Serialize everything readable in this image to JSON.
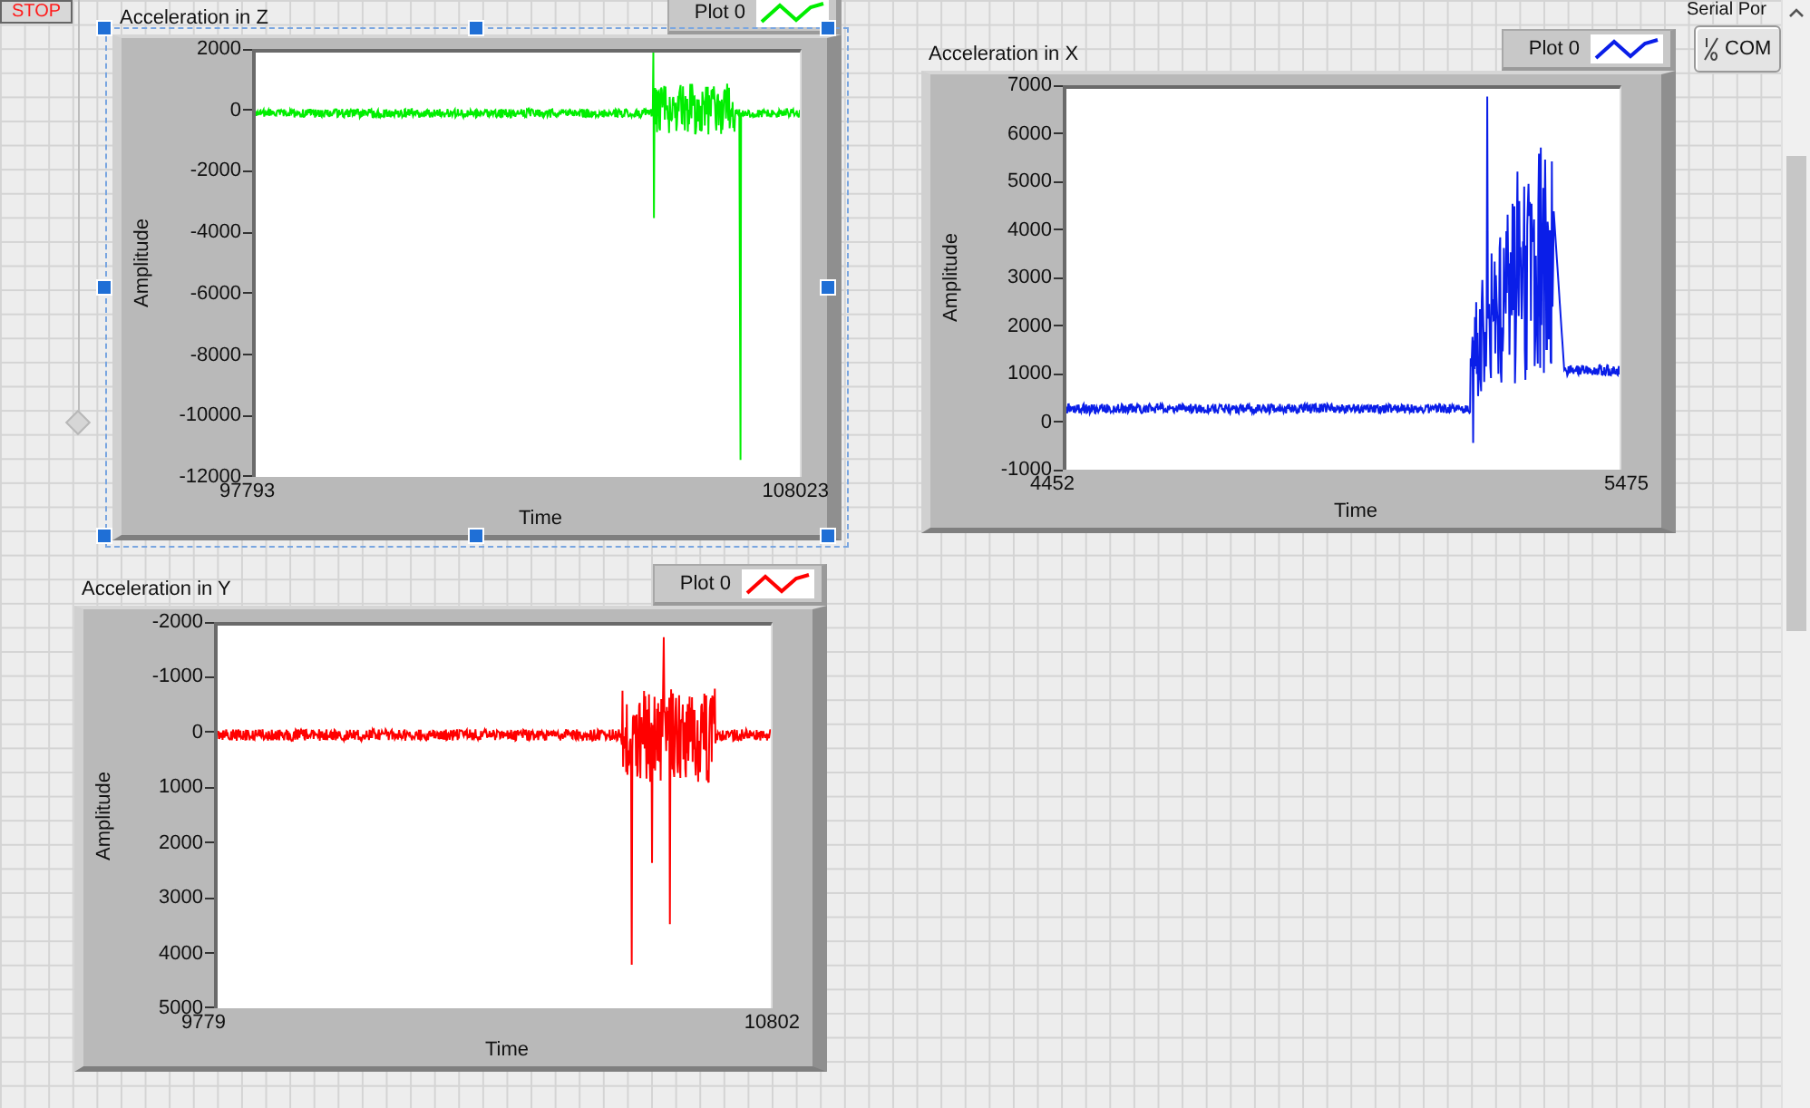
{
  "stop_button": {
    "label": "STOP"
  },
  "charts": [
    {
      "title": "Acceleration in Z",
      "selected": true,
      "color": "#00ee00",
      "legend": {
        "label": "Plot 0"
      },
      "y_axis": {
        "label": "Amplitude",
        "ticks": [
          "2000",
          "0",
          "-2000",
          "-4000",
          "-6000",
          "-8000",
          "-10000",
          "-12000"
        ]
      },
      "x_axis": {
        "label": "Time",
        "ticks": [
          "97793",
          "108023"
        ]
      }
    },
    {
      "title": "Acceleration in X",
      "selected": false,
      "color": "#0a1ee8",
      "legend": {
        "label": "Plot 0"
      },
      "y_axis": {
        "label": "Amplitude",
        "ticks": [
          "7000",
          "6000",
          "5000",
          "4000",
          "3000",
          "2000",
          "1000",
          "0",
          "-1000"
        ]
      },
      "x_axis": {
        "label": "Time",
        "ticks": [
          "4452",
          "5475"
        ]
      }
    },
    {
      "title": "Acceleration in Y",
      "selected": false,
      "color": "#ff0000",
      "legend": {
        "label": "Plot 0"
      },
      "y_axis": {
        "label": "Amplitude",
        "ticks": [
          "-2000",
          "-1000",
          "0",
          "1000",
          "2000",
          "3000",
          "4000",
          "5000"
        ]
      },
      "x_axis": {
        "label": "Time",
        "ticks": [
          "9779",
          "10802"
        ]
      }
    }
  ],
  "serial_port": {
    "label": "Serial Por",
    "value": "COM"
  }
}
